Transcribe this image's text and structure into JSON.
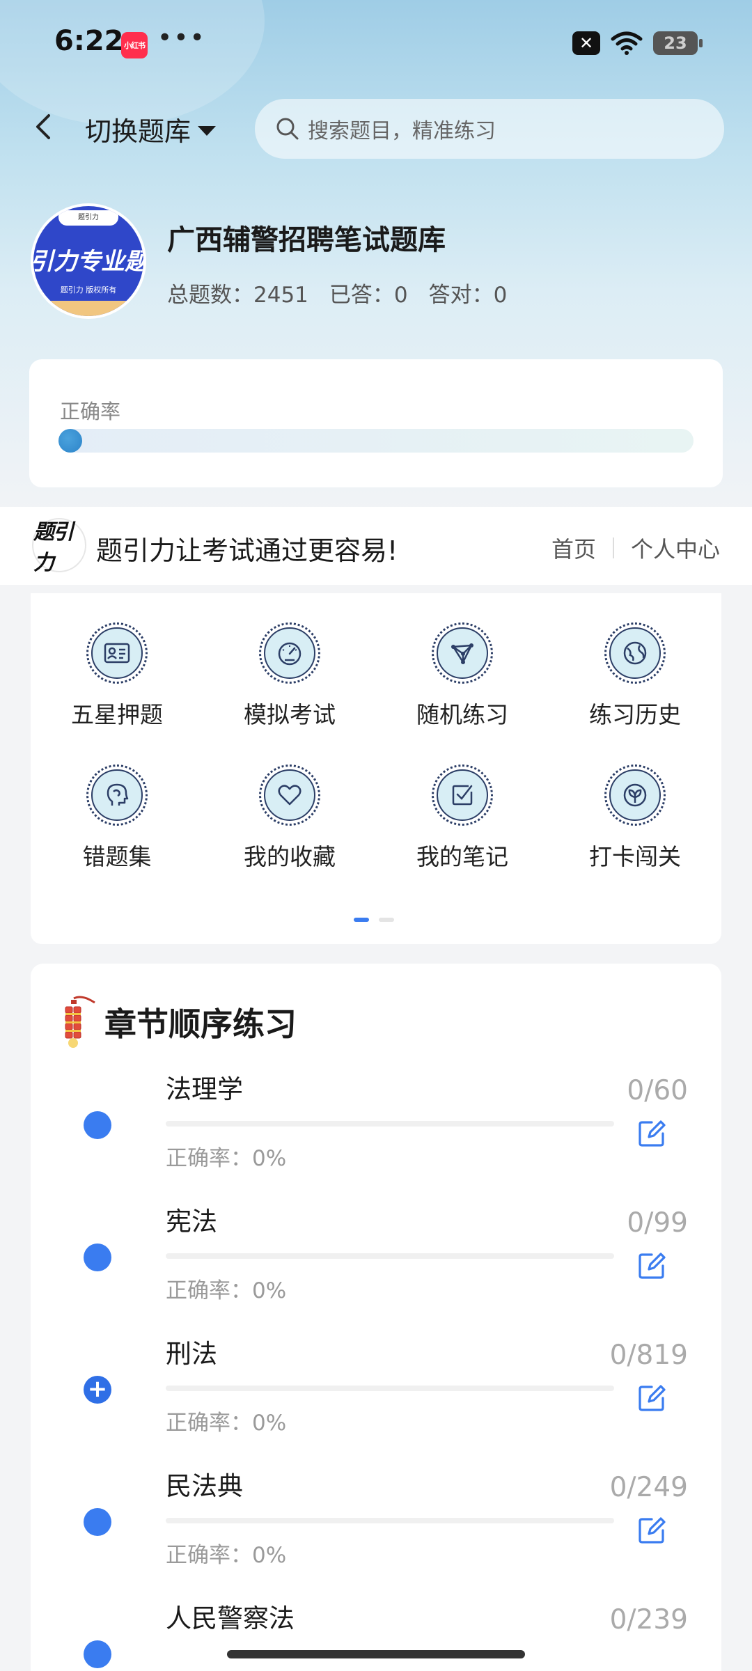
{
  "status_bar": {
    "time": "6:22",
    "app_badge": "小红书",
    "dots": "•••",
    "sim_label": "✕",
    "battery": "23"
  },
  "header": {
    "switch_label": "切换题库",
    "search_placeholder": "搜索题目，精准练习"
  },
  "bank": {
    "logo_top": "题引力",
    "logo_main": "引力专业题",
    "logo_sub": "题引力 版权所有",
    "title": "广西辅警招聘笔试题库",
    "stats": {
      "total": "总题数：2451",
      "answered": "已答：0",
      "correct": "答对：0"
    }
  },
  "accuracy": {
    "label": "正确率",
    "value": 0
  },
  "brand": {
    "logo_text": "题引力",
    "slogan": "题引力让考试通过更容易!",
    "links": {
      "home": "首页",
      "profile": "个人中心"
    }
  },
  "features": [
    {
      "label": "五星押题",
      "icon": "id-card-icon"
    },
    {
      "label": "模拟考试",
      "icon": "gauge-icon"
    },
    {
      "label": "随机练习",
      "icon": "network-icon"
    },
    {
      "label": "练习历史",
      "icon": "globe-icon"
    },
    {
      "label": "错题集",
      "icon": "head-icon"
    },
    {
      "label": "我的收藏",
      "icon": "heart-icon"
    },
    {
      "label": "我的笔记",
      "icon": "note-check-icon"
    },
    {
      "label": "打卡闯关",
      "icon": "leaf-icon"
    }
  ],
  "chapters": {
    "title": "章节顺序练习",
    "items": [
      {
        "name": "法理学",
        "accuracy": "正确率：0%",
        "count": "0/60",
        "marker": "dot"
      },
      {
        "name": "宪法",
        "accuracy": "正确率：0%",
        "count": "0/99",
        "marker": "dot"
      },
      {
        "name": "刑法",
        "accuracy": "正确率：0%",
        "count": "0/819",
        "marker": "plus"
      },
      {
        "name": "民法典",
        "accuracy": "正确率：0%",
        "count": "0/249",
        "marker": "dot"
      },
      {
        "name": "人民警察法",
        "accuracy": "",
        "count": "0/239",
        "marker": "dot"
      }
    ]
  },
  "colors": {
    "accent": "#3a7cf0",
    "icon_fill": "#d8eef5",
    "icon_stroke": "#2c3e66"
  }
}
